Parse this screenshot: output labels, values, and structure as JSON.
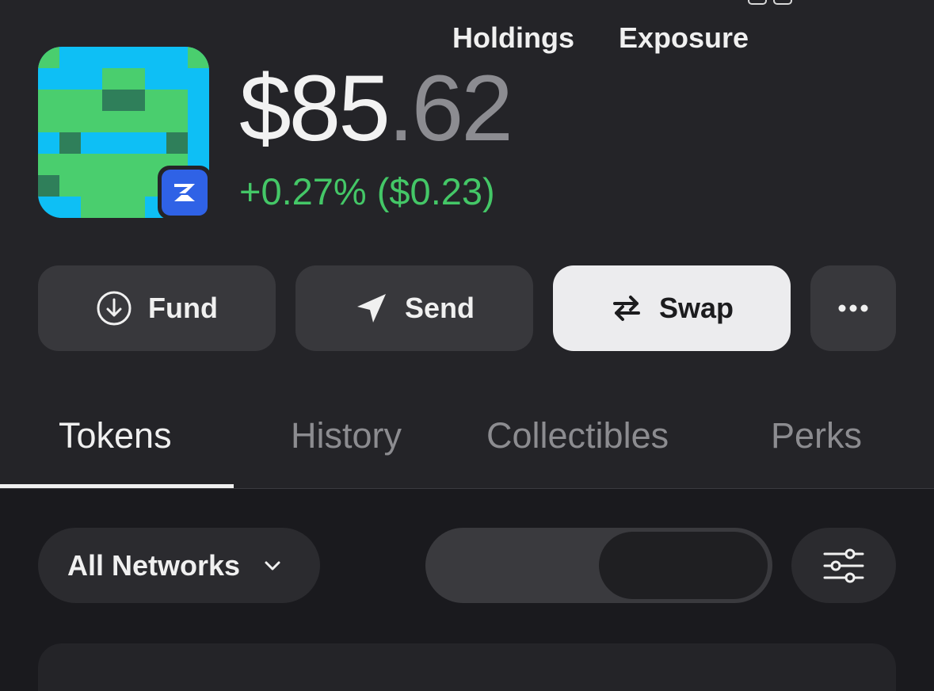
{
  "wallet": {
    "balance_whole": "$85",
    "balance_decimal": ".62",
    "change_text": "+0.27% ($0.23)",
    "change_color": "#44c767",
    "avatar_icon": "pixel-avatar-icon",
    "badge_icon": "network-badge-icon",
    "badge_color": "#2f62e6"
  },
  "actions": [
    {
      "label": "Fund",
      "icon": "download-circle-icon"
    },
    {
      "label": "Send",
      "icon": "paper-plane-icon"
    },
    {
      "label": "Swap",
      "icon": "swap-arrows-icon"
    },
    {
      "label": "",
      "icon": "more-horizontal-icon"
    }
  ],
  "tabs": [
    {
      "label": "Tokens",
      "active": true
    },
    {
      "label": "History",
      "active": false
    },
    {
      "label": "Collectibles",
      "active": false
    },
    {
      "label": "Perks",
      "active": false
    }
  ],
  "filters": {
    "network_select": "All Networks",
    "view_options": [
      "Holdings",
      "Exposure"
    ],
    "view_selected": "Exposure",
    "settings_icon": "sliders-icon"
  }
}
